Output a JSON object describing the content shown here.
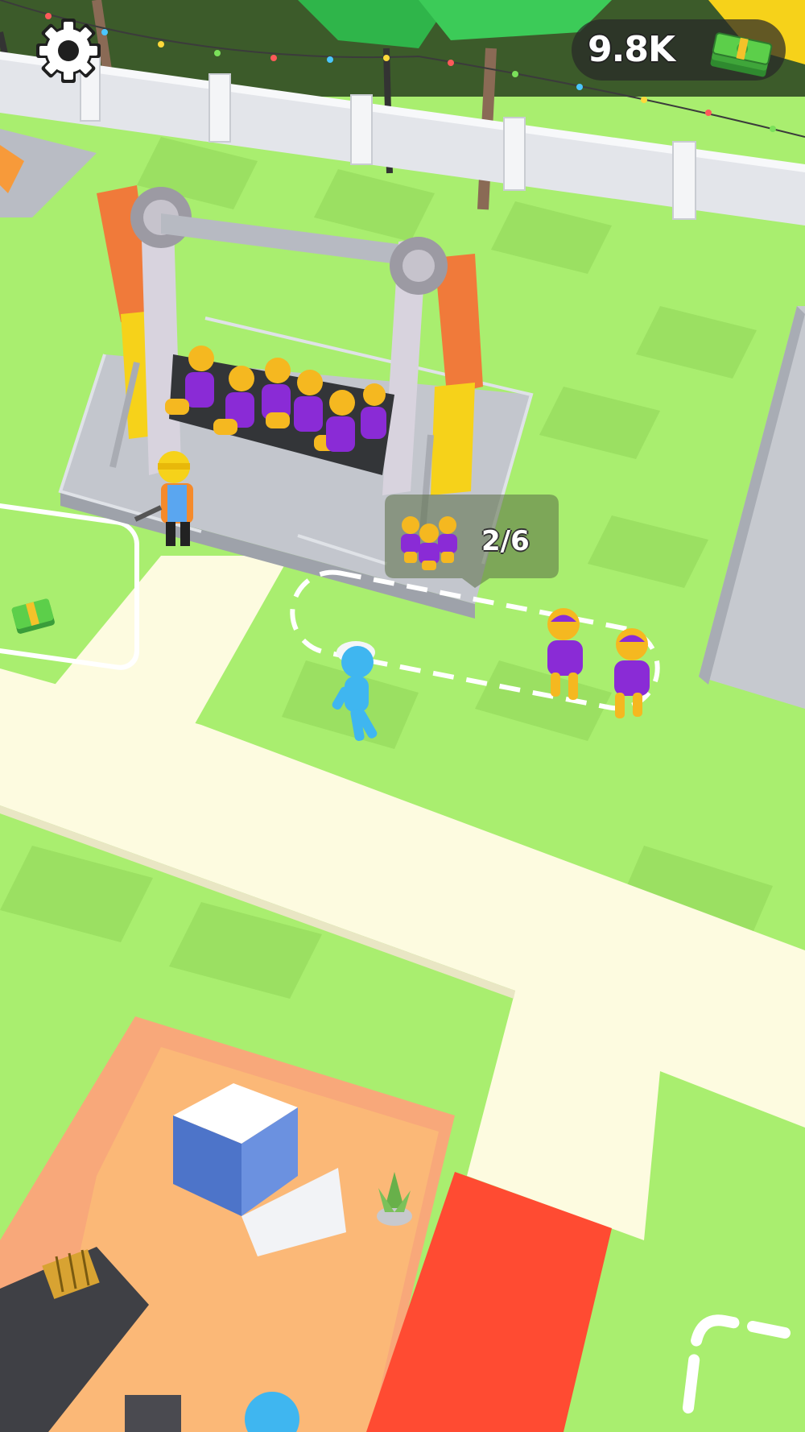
{
  "hud": {
    "money_text": "9.8K",
    "settings_icon": "gear-icon",
    "money_icon": "cash-stack-icon"
  },
  "ride": {
    "queue_text": "2/6",
    "queue_icon": "people-group-icon"
  },
  "colors": {
    "grass": "#a9ee6f",
    "grass_dark": "#9be062",
    "path": "#fdfbe0",
    "ride_frame": "#f07a3a",
    "ride_platform": "#b9bcc4",
    "visitor_shirt": "#8a2bd6",
    "visitor_body": "#f5b820",
    "player": "#3fb6f0",
    "red_carpet": "#ff4b32",
    "building_floor": "#f9b877"
  }
}
